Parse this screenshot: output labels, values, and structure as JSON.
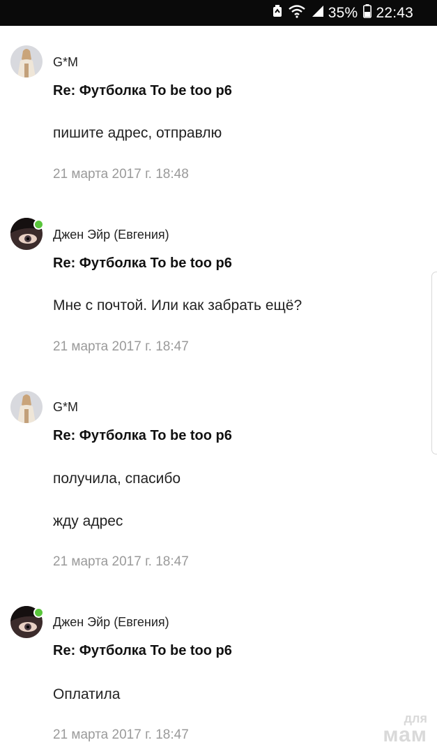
{
  "status_bar": {
    "battery_percent": "35%",
    "time": "22:43",
    "icons": [
      "sync-icon",
      "wifi-icon",
      "signal-icon",
      "battery-icon"
    ]
  },
  "messages": [
    {
      "author": "G*M",
      "online": false,
      "subject": "Re: Футболка To be too p6",
      "lines": [
        "пишите адрес, отправлю"
      ],
      "time": "21 марта 2017 г. 18:48"
    },
    {
      "author": "Джен Эйр (Евгения)",
      "online": true,
      "subject": "Re: Футболка To be too p6",
      "lines": [
        "Мне с почтой. Или как забрать ещё?"
      ],
      "time": "21 марта 2017 г. 18:47"
    },
    {
      "author": "G*M",
      "online": false,
      "subject": "Re: Футболка To be too p6",
      "lines": [
        "получила, спасибо",
        "жду адрес"
      ],
      "time": "21 марта 2017 г. 18:47"
    },
    {
      "author": "Джен Эйр (Евгения)",
      "online": true,
      "subject": "Re: Футболка To be too p6",
      "lines": [
        "Оплатила"
      ],
      "time": "21 марта 2017 г. 18:47"
    }
  ],
  "watermark": {
    "line1": "для",
    "line2": "мам"
  },
  "colors": {
    "online": "#59c53b",
    "time_text": "#9a9a9a",
    "status_bar_bg": "#0a0a0a"
  }
}
